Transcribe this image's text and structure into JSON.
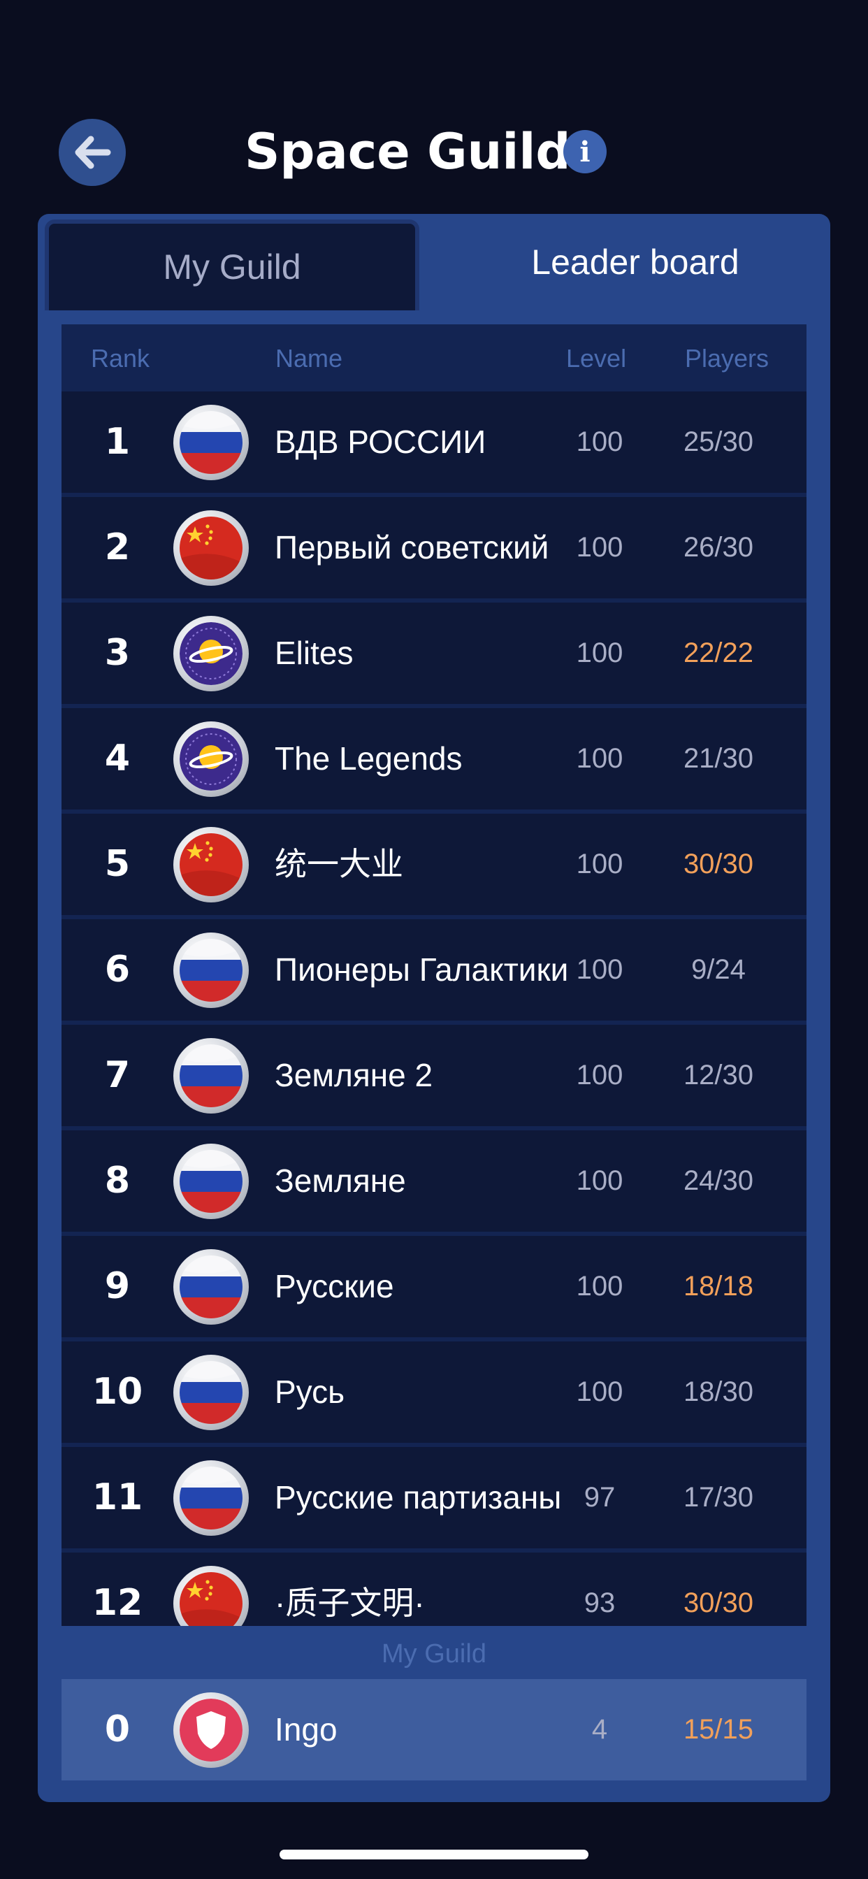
{
  "header": {
    "title": "Space Guilds",
    "back_icon": "arrow-left-icon",
    "info_label": "i"
  },
  "tabs": [
    {
      "label": "My Guild",
      "active": false
    },
    {
      "label": "Leader board",
      "active": true
    }
  ],
  "columns": {
    "rank": "Rank",
    "name": "Name",
    "level": "Level",
    "players": "Players"
  },
  "rows": [
    {
      "rank": "1",
      "icon": "russia-flag-icon",
      "name": "ВДВ РОССИИ",
      "level": "100",
      "players": "25/30",
      "full": false
    },
    {
      "rank": "2",
      "icon": "china-flag-icon",
      "name": "Первый советский",
      "level": "100",
      "players": "26/30",
      "full": false
    },
    {
      "rank": "3",
      "icon": "planet-icon",
      "name": "Elites",
      "level": "100",
      "players": "22/22",
      "full": true
    },
    {
      "rank": "4",
      "icon": "planet-icon",
      "name": "The Legends",
      "level": "100",
      "players": "21/30",
      "full": false
    },
    {
      "rank": "5",
      "icon": "china-flag-icon",
      "name": "统一大业",
      "level": "100",
      "players": "30/30",
      "full": true
    },
    {
      "rank": "6",
      "icon": "russia-flag-icon",
      "name": "Пионеры Галактики",
      "level": "100",
      "players": "9/24",
      "full": false
    },
    {
      "rank": "7",
      "icon": "russia-flag-icon",
      "name": "Земляне 2",
      "level": "100",
      "players": "12/30",
      "full": false
    },
    {
      "rank": "8",
      "icon": "russia-flag-icon",
      "name": "Земляне",
      "level": "100",
      "players": "24/30",
      "full": false
    },
    {
      "rank": "9",
      "icon": "russia-flag-icon",
      "name": "Русские",
      "level": "100",
      "players": "18/18",
      "full": true
    },
    {
      "rank": "10",
      "icon": "russia-flag-icon",
      "name": "Русь",
      "level": "100",
      "players": "18/30",
      "full": false
    },
    {
      "rank": "11",
      "icon": "russia-flag-icon",
      "name": "Русские партизаны",
      "level": "97",
      "players": "17/30",
      "full": false
    },
    {
      "rank": "12",
      "icon": "china-flag-icon",
      "name": "·质子文明·",
      "level": "93",
      "players": "30/30",
      "full": true
    }
  ],
  "my_guild": {
    "section_label": "My Guild",
    "rank": "0",
    "icon": "shield-icon",
    "name": "Ingo",
    "level": "4",
    "players": "15/15",
    "full": true
  },
  "colors": {
    "background": "#0a0d1f",
    "panel": "#27468a",
    "row": "#0e1838",
    "my_row": "#3e5d9e",
    "full_players": "#f2a05a"
  }
}
